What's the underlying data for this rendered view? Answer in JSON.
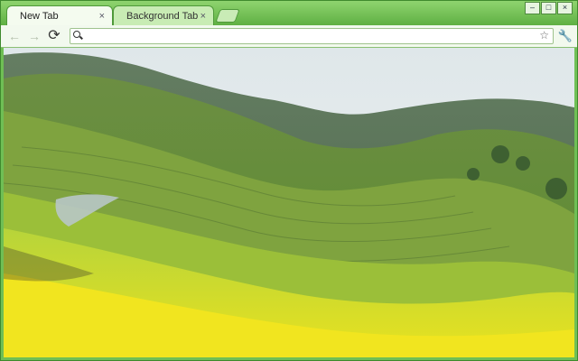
{
  "tabs": [
    {
      "label": "New Tab",
      "close": "×"
    },
    {
      "label": "Background Tab",
      "close": "×"
    }
  ],
  "window_controls": {
    "minimize": "–",
    "maximize": "□",
    "close": "×"
  },
  "nav": {
    "back": "←",
    "forward": "→",
    "reload": "⟳"
  },
  "omnibox": {
    "value": "",
    "star": "☆"
  },
  "menu": {
    "wrench": "🔧"
  },
  "theme": {
    "frame": "#6fbf55",
    "toolbar": "#f2f9ee"
  },
  "content": {
    "image": "terraced rapeseed field landscape photo"
  }
}
